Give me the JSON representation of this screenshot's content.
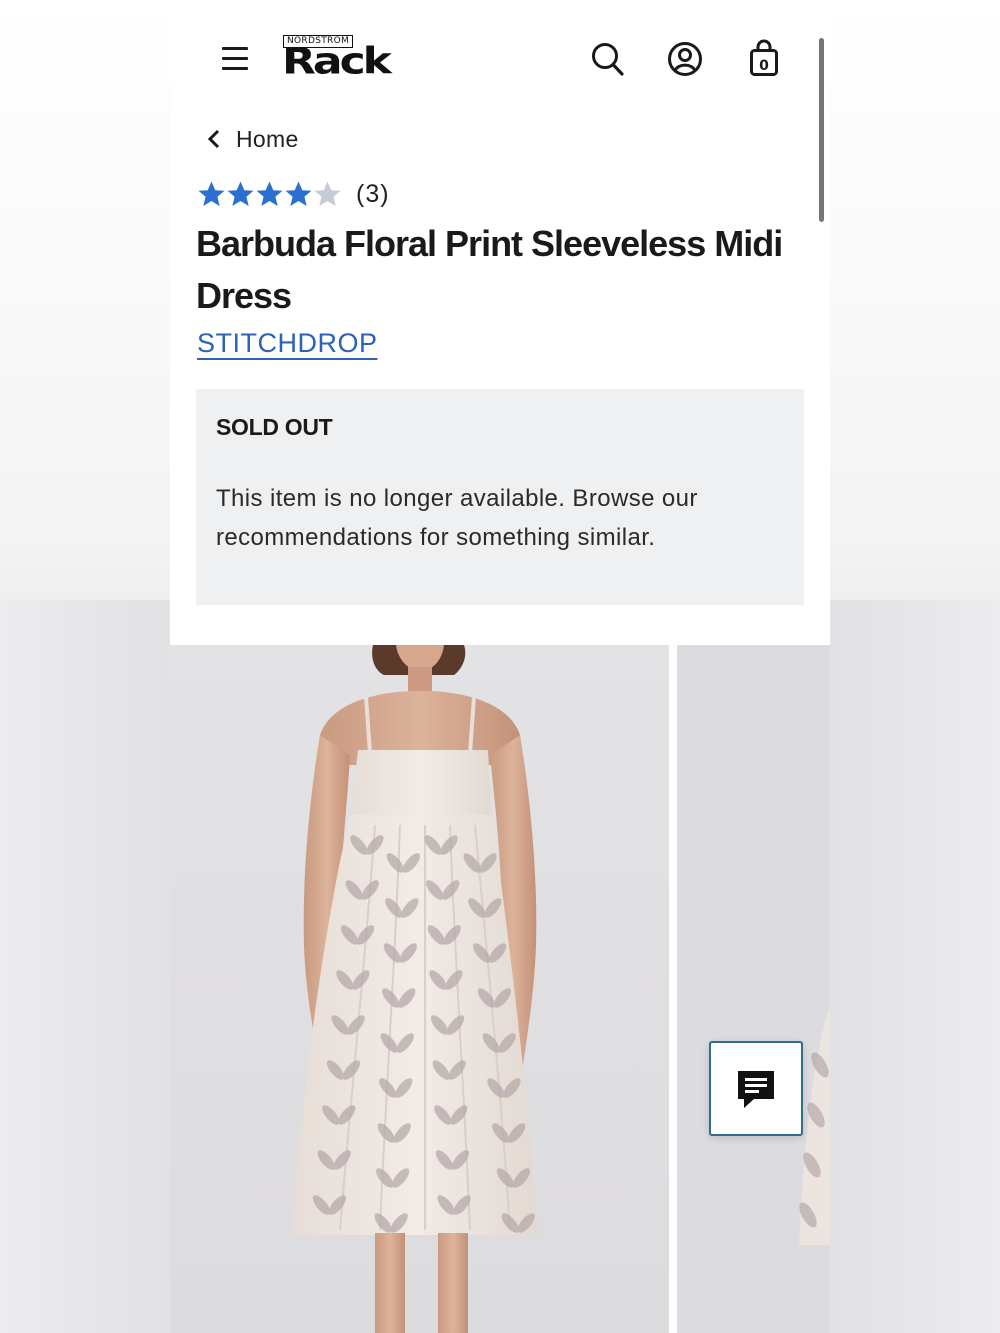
{
  "header": {
    "logo_top": "NORDSTROM",
    "logo_main": "Rack",
    "menu_icon": "hamburger-menu-icon",
    "search_icon": "search-icon",
    "account_icon": "account-icon",
    "bag_icon": "shopping-bag-icon",
    "bag_count": "0"
  },
  "breadcrumb": {
    "label": "Home"
  },
  "product": {
    "rating": 4,
    "rating_max": 5,
    "review_count": "(3)",
    "title": "Barbuda Floral Print Sleeveless Midi Dress",
    "brand": "STITCHDROP"
  },
  "availability": {
    "heading": "SOLD OUT",
    "message": "This item is no longer available. Browse our recommendations for something similar."
  },
  "chat": {
    "icon": "chat-message-icon"
  },
  "colors": {
    "star_filled": "#2b6fd1",
    "star_empty": "#c5ccd3",
    "brand_link": "#2d62b8",
    "chat_border": "#2f6d8e",
    "sold_box_bg": "#eef0f2"
  }
}
